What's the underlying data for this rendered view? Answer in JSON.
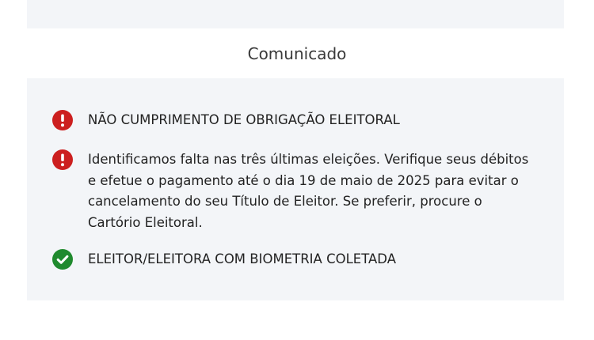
{
  "section": {
    "title": "Comunicado"
  },
  "notices": [
    {
      "status": "error",
      "icon": "exclamation-circle-icon",
      "text": "NÃO CUMPRIMENTO DE OBRIGAÇÃO ELEITORAL"
    },
    {
      "status": "error",
      "icon": "exclamation-circle-icon",
      "text": "Identificamos falta nas três últimas eleições. Verifique seus débitos e efetue o pagamento até o dia 19 de maio de 2025 para evitar o cancelamento do seu Título de Eleitor. Se preferir, procure o Cartório Eleitoral."
    },
    {
      "status": "success",
      "icon": "check-circle-icon",
      "text": "ELEITOR/ELEITORA COM BIOMETRIA COLETADA"
    }
  ],
  "colors": {
    "error": "#cc1f1f",
    "success": "#1f8a2e",
    "card_background": "#f3f5f8"
  }
}
